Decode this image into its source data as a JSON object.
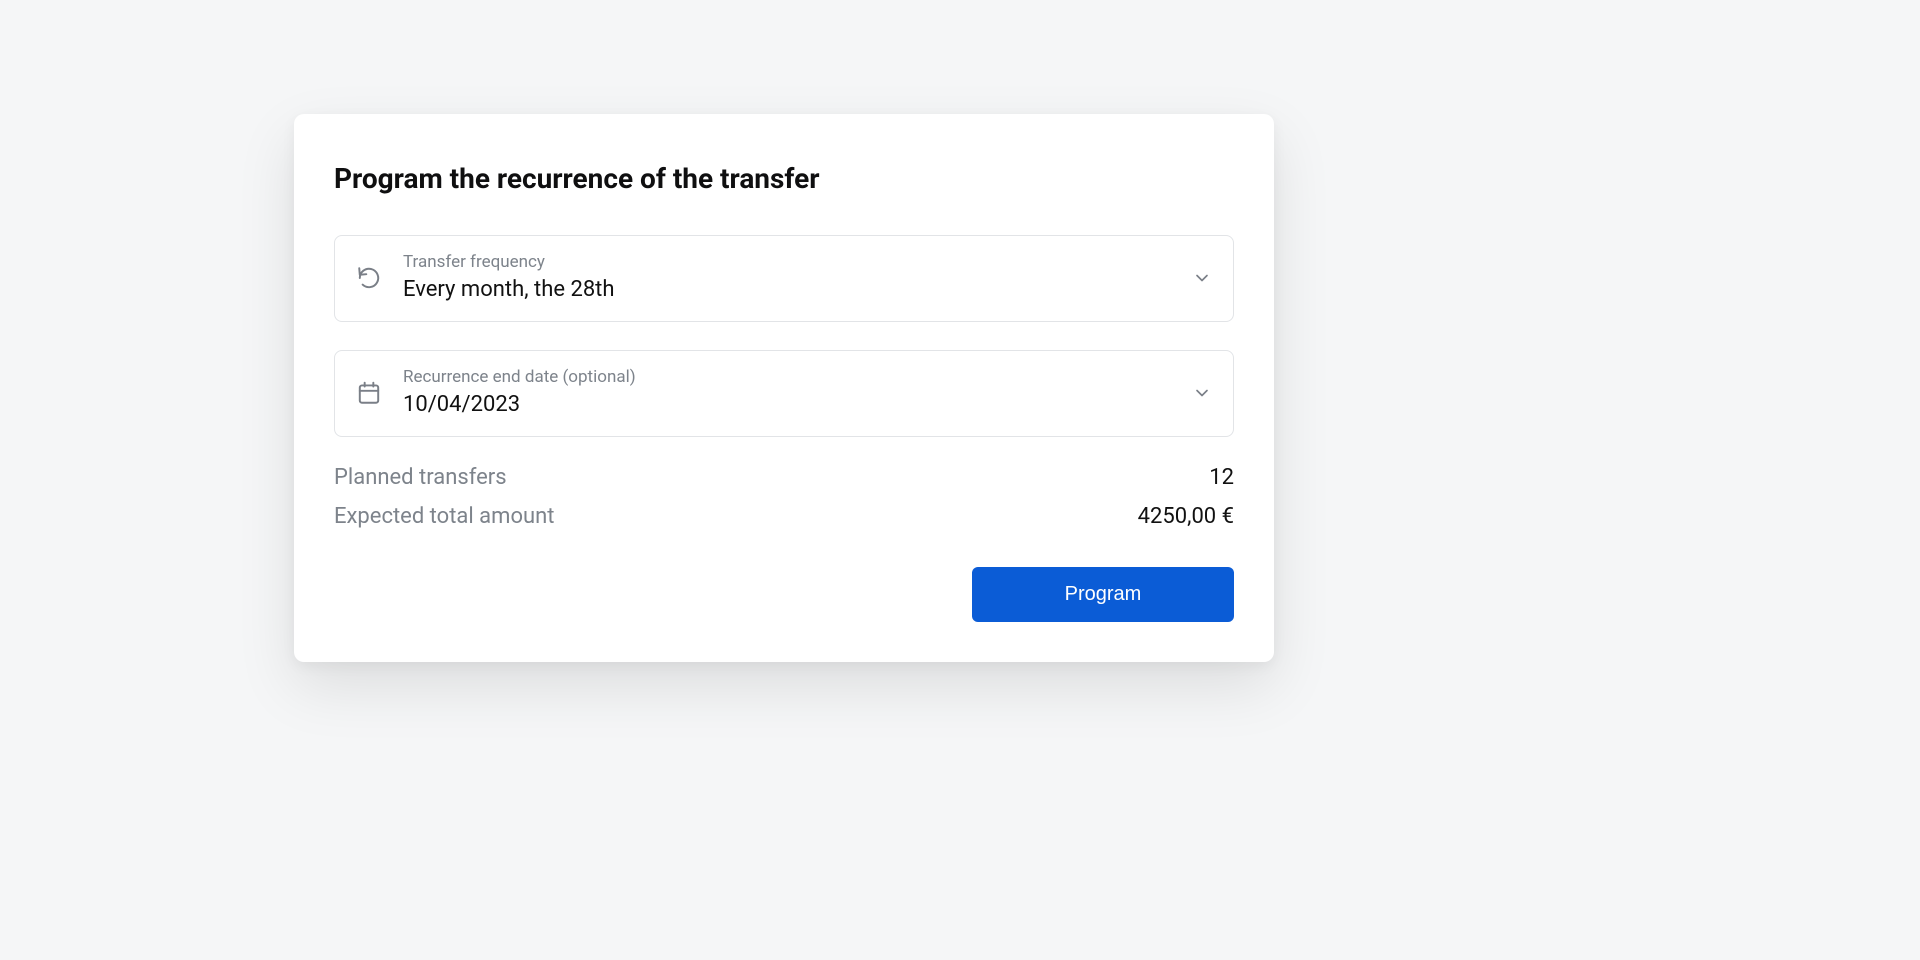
{
  "title": "Program the recurrence of the transfer",
  "fields": {
    "frequency": {
      "label": "Transfer frequency",
      "value": "Every month, the 28th"
    },
    "end_date": {
      "label": "Recurrence end date (optional)",
      "value": "10/04/2023"
    }
  },
  "summary": {
    "planned_transfers": {
      "label": "Planned transfers",
      "value": "12"
    },
    "expected_total": {
      "label": "Expected total amount",
      "value": "4250,00 €"
    }
  },
  "actions": {
    "program_label": "Program"
  },
  "colors": {
    "primary": "#0b5cd6"
  }
}
